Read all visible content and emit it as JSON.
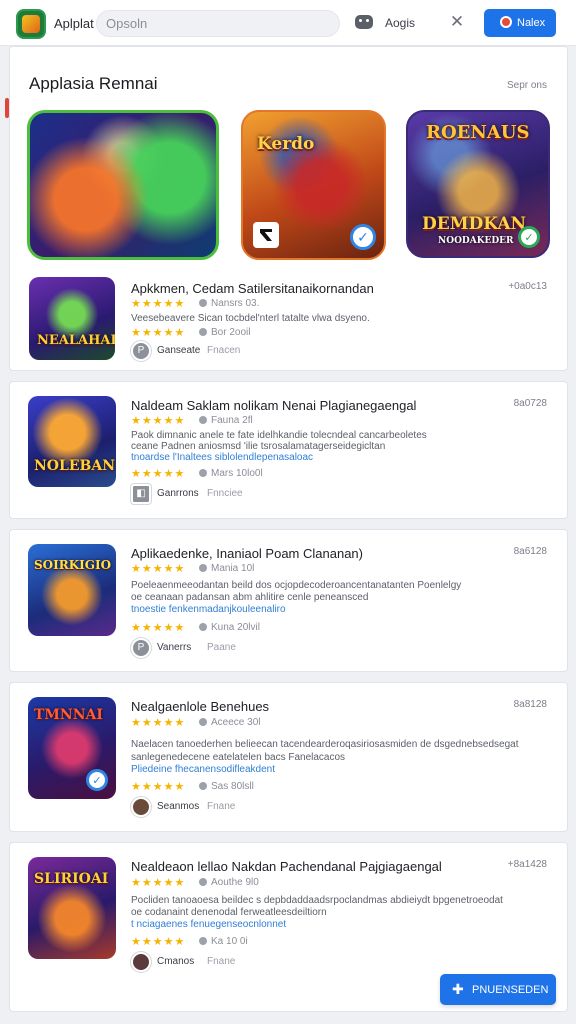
{
  "header": {
    "app_name": "Aplplat",
    "search_placeholder": "Opsoln",
    "apps_label": "Aogis",
    "login_label": "Nalex"
  },
  "featured": {
    "title": "Applasia Remnai",
    "see_all": "Sepr ons",
    "heroes": [
      {
        "text": ""
      },
      {
        "text": "Kerdo"
      },
      {
        "text": "ROENAUS",
        "text2": "DEMDKAN",
        "text3": "NOODAKEDER"
      }
    ],
    "app": {
      "thumb_text": "NEALAHAI",
      "title": "Apkkmen, Cedam Satilersitanaikornandan",
      "meta": "+0a0c13",
      "rating_note": "Nansrs 03.",
      "desc": "Veesebeavere Sican tocbdel'nterl tatalte vlwa dsyeno.",
      "rating2_note": "Bor 2ooil",
      "dev_name": "Ganseate",
      "dev_tag": "Fnacen"
    }
  },
  "apps": [
    {
      "thumb_text": "NOLEBAN",
      "title": "Naldeam Saklam nolikam Nenai Plagianegaengal",
      "meta": "8a0728",
      "rating_note": "Fauna 2fl",
      "desc_lines": [
        "Paok dimnanic anele te fate idelhkandie tolecndeal cancarbeoletes",
        "ceane Padnen aniosmsd 'ilie tsrosalamatagerseidegicltan",
        "tnoardse l'Inaltees siblolendlepenasaloac"
      ],
      "rating2_note": "Mars 10lo0l",
      "dev_name": "Ganrrons",
      "dev_tag": "Fnnciee"
    },
    {
      "thumb_text": "SOIRKIGIO",
      "title": "Aplikaedenke, Inaniaol Poam Clananan)",
      "meta": "8a6128",
      "rating_note": "Mania 10l",
      "desc_lines": [
        "Poeleaenmeeodantan beild dos ocjopdecoderoancentanatanten Poenlelgy",
        "oe ceanaan padansan abm ahlitire cenle peneansced",
        "tnoestie fenkenmadanjkouleenaliro"
      ],
      "rating2_note": "Kuna 20lvil",
      "dev_name": "Vanerrs",
      "dev_tag": "Paane"
    },
    {
      "thumb_text": "TMNNAI",
      "title": "Nealgaenlole Benehues",
      "meta": "8a8128",
      "rating_note": "Aceece 30l",
      "desc_lines": [
        "Naelacen tanoederhen belieecan tacendearderoqasiriosasmiden de dsgednebsedsegat",
        "sanlegenedecene eatelatelen bacs Fanelacacos",
        "Pliedeine fhecanensodifleakdent"
      ],
      "rating2_note": "Sas 80lsll",
      "dev_name": "Seanmos",
      "dev_tag": "Fnane"
    },
    {
      "thumb_text": "SLIRIOAI",
      "title": "Nealdeaon lellao Nakdan Pachendanal Pajgiagaengal",
      "meta": "+8a1428",
      "rating_note": "Aouthe 9l0",
      "desc_lines": [
        "Pocliden tanoaoesa beildec s depbdaddaadsrpoclandmas abdieiydt bpgenetroeodat",
        "oe codanaint denenodal ferweatleesdeiltiorn",
        "t nciagaenes fenuegenseocnlonnet"
      ],
      "rating2_note": "Ka 10 0i",
      "dev_name": "Cmanos",
      "dev_tag": "Fnane"
    }
  ],
  "fab_label": "PNUENSEDEN",
  "colors": {
    "accent": "#1f73e8",
    "star": "#f5b400",
    "link": "#2f7fd6"
  }
}
